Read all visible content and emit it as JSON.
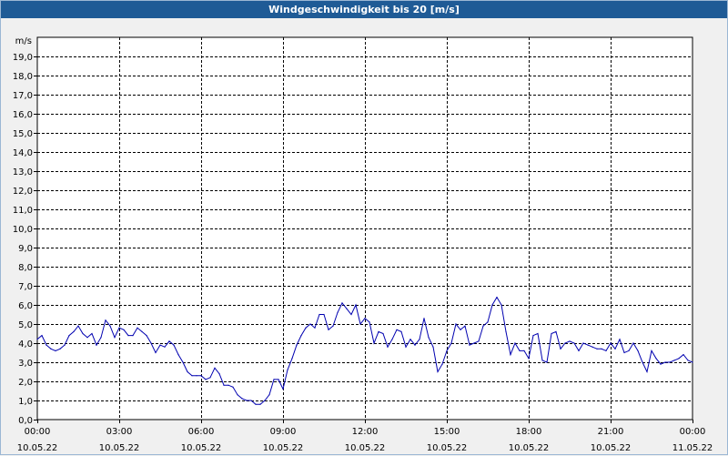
{
  "window": {
    "title": "Windgeschwindigkeit bis 20 [m/s]"
  },
  "colors": {
    "titlebar": "#1f5b96",
    "line": "#0000b0",
    "grid": "#000000",
    "plot_bg": "#ffffff"
  },
  "chart_data": {
    "type": "line",
    "title": "Windgeschwindigkeit bis 20 [m/s]",
    "ylabel": "m/s",
    "xlabel": "",
    "ylim": [
      0,
      20
    ],
    "y_ticks": [
      "0,0",
      "1,0",
      "2,0",
      "3,0",
      "4,0",
      "5,0",
      "6,0",
      "7,0",
      "8,0",
      "9,0",
      "10,0",
      "11,0",
      "12,0",
      "13,0",
      "14,0",
      "15,0",
      "16,0",
      "17,0",
      "18,0",
      "19,0"
    ],
    "x_ticks": [
      {
        "time": "00:00",
        "date": "10.05.22"
      },
      {
        "time": "03:00",
        "date": "10.05.22"
      },
      {
        "time": "06:00",
        "date": "10.05.22"
      },
      {
        "time": "09:00",
        "date": "10.05.22"
      },
      {
        "time": "12:00",
        "date": "10.05.22"
      },
      {
        "time": "15:00",
        "date": "10.05.22"
      },
      {
        "time": "18:00",
        "date": "10.05.22"
      },
      {
        "time": "21:00",
        "date": "10.05.22"
      },
      {
        "time": "00:00",
        "date": "11.05.22"
      }
    ],
    "xlim": [
      "10.05.22 00:00",
      "11.05.22 00:00"
    ],
    "grid": true,
    "series": [
      {
        "color": "#0000b0",
        "points": [
          [
            "00:00",
            4.2
          ],
          [
            "00:10",
            4.4
          ],
          [
            "00:20",
            3.9
          ],
          [
            "00:30",
            3.7
          ],
          [
            "00:40",
            3.6
          ],
          [
            "00:50",
            3.7
          ],
          [
            "01:00",
            3.9
          ],
          [
            "01:10",
            4.4
          ],
          [
            "01:20",
            4.6
          ],
          [
            "01:30",
            4.9
          ],
          [
            "01:40",
            4.5
          ],
          [
            "01:50",
            4.3
          ],
          [
            "02:00",
            4.5
          ],
          [
            "02:10",
            3.9
          ],
          [
            "02:20",
            4.3
          ],
          [
            "02:30",
            5.2
          ],
          [
            "02:40",
            4.9
          ],
          [
            "02:50",
            4.3
          ],
          [
            "03:00",
            4.8
          ],
          [
            "03:10",
            4.7
          ],
          [
            "03:20",
            4.4
          ],
          [
            "03:30",
            4.4
          ],
          [
            "03:40",
            4.8
          ],
          [
            "03:50",
            4.6
          ],
          [
            "04:00",
            4.4
          ],
          [
            "04:10",
            4.0
          ],
          [
            "04:20",
            3.5
          ],
          [
            "04:30",
            3.9
          ],
          [
            "04:40",
            3.8
          ],
          [
            "04:50",
            4.1
          ],
          [
            "05:00",
            3.9
          ],
          [
            "05:10",
            3.4
          ],
          [
            "05:20",
            3.0
          ],
          [
            "05:30",
            2.5
          ],
          [
            "05:40",
            2.3
          ],
          [
            "05:50",
            2.3
          ],
          [
            "06:00",
            2.3
          ],
          [
            "06:10",
            2.1
          ],
          [
            "06:20",
            2.2
          ],
          [
            "06:30",
            2.7
          ],
          [
            "06:40",
            2.4
          ],
          [
            "06:50",
            1.8
          ],
          [
            "07:00",
            1.8
          ],
          [
            "07:10",
            1.7
          ],
          [
            "07:20",
            1.3
          ],
          [
            "07:30",
            1.1
          ],
          [
            "07:40",
            1.0
          ],
          [
            "07:50",
            1.0
          ],
          [
            "08:00",
            0.8
          ],
          [
            "08:10",
            0.8
          ],
          [
            "08:20",
            1.0
          ],
          [
            "08:30",
            1.3
          ],
          [
            "08:40",
            2.1
          ],
          [
            "08:50",
            2.1
          ],
          [
            "09:00",
            1.6
          ],
          [
            "09:10",
            2.6
          ],
          [
            "09:20",
            3.2
          ],
          [
            "09:30",
            3.9
          ],
          [
            "09:40",
            4.4
          ],
          [
            "09:50",
            4.8
          ],
          [
            "10:00",
            5.0
          ],
          [
            "10:10",
            4.8
          ],
          [
            "10:20",
            5.5
          ],
          [
            "10:30",
            5.5
          ],
          [
            "10:40",
            4.7
          ],
          [
            "10:50",
            4.9
          ],
          [
            "11:00",
            5.6
          ],
          [
            "11:10",
            6.1
          ],
          [
            "11:20",
            5.8
          ],
          [
            "11:30",
            5.5
          ],
          [
            "11:40",
            6.0
          ],
          [
            "11:50",
            5.0
          ],
          [
            "12:00",
            5.3
          ],
          [
            "12:10",
            5.1
          ],
          [
            "12:20",
            4.0
          ],
          [
            "12:30",
            4.6
          ],
          [
            "12:40",
            4.5
          ],
          [
            "12:50",
            3.8
          ],
          [
            "13:00",
            4.2
          ],
          [
            "13:10",
            4.7
          ],
          [
            "13:20",
            4.6
          ],
          [
            "13:30",
            3.8
          ],
          [
            "13:40",
            4.2
          ],
          [
            "13:50",
            3.9
          ],
          [
            "14:00",
            4.2
          ],
          [
            "14:10",
            5.3
          ],
          [
            "14:20",
            4.3
          ],
          [
            "14:30",
            3.8
          ],
          [
            "14:40",
            2.5
          ],
          [
            "14:50",
            2.9
          ],
          [
            "15:00",
            3.6
          ],
          [
            "15:10",
            4.0
          ],
          [
            "15:20",
            5.0
          ],
          [
            "15:30",
            4.7
          ],
          [
            "15:40",
            4.9
          ],
          [
            "15:50",
            3.9
          ],
          [
            "16:00",
            4.0
          ],
          [
            "16:10",
            4.1
          ],
          [
            "16:20",
            4.9
          ],
          [
            "16:30",
            5.1
          ],
          [
            "16:40",
            6.0
          ],
          [
            "16:50",
            6.4
          ],
          [
            "17:00",
            6.0
          ],
          [
            "17:10",
            4.6
          ],
          [
            "17:20",
            3.4
          ],
          [
            "17:30",
            4.0
          ],
          [
            "17:40",
            3.6
          ],
          [
            "17:50",
            3.6
          ],
          [
            "18:00",
            3.2
          ],
          [
            "18:10",
            4.4
          ],
          [
            "18:20",
            4.5
          ],
          [
            "18:30",
            3.1
          ],
          [
            "18:40",
            3.0
          ],
          [
            "18:50",
            4.5
          ],
          [
            "19:00",
            4.6
          ],
          [
            "19:10",
            3.7
          ],
          [
            "19:20",
            4.0
          ],
          [
            "19:30",
            4.1
          ],
          [
            "19:40",
            4.0
          ],
          [
            "19:50",
            3.6
          ],
          [
            "20:00",
            4.0
          ],
          [
            "20:10",
            3.9
          ],
          [
            "20:20",
            3.8
          ],
          [
            "20:30",
            3.7
          ],
          [
            "20:40",
            3.7
          ],
          [
            "20:50",
            3.6
          ],
          [
            "21:00",
            4.0
          ],
          [
            "21:10",
            3.7
          ],
          [
            "21:20",
            4.2
          ],
          [
            "21:30",
            3.5
          ],
          [
            "21:40",
            3.6
          ],
          [
            "21:50",
            4.0
          ],
          [
            "22:00",
            3.6
          ],
          [
            "22:10",
            3.0
          ],
          [
            "22:20",
            2.5
          ],
          [
            "22:30",
            3.6
          ],
          [
            "22:40",
            3.2
          ],
          [
            "22:50",
            2.9
          ],
          [
            "23:00",
            3.0
          ],
          [
            "23:10",
            3.0
          ],
          [
            "23:20",
            3.1
          ],
          [
            "23:30",
            3.2
          ],
          [
            "23:40",
            3.4
          ],
          [
            "23:50",
            3.1
          ],
          [
            "24:00",
            3.0
          ]
        ]
      }
    ]
  }
}
